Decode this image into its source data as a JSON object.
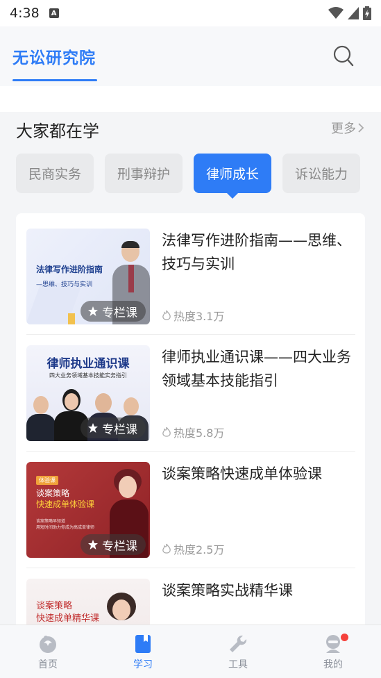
{
  "status": {
    "time": "4:38",
    "indicator": "A"
  },
  "header": {
    "brand_tab": "无讼研究院",
    "search_icon": "search-icon"
  },
  "section": {
    "title": "大家都在学",
    "more_label": "更多"
  },
  "categories": [
    {
      "label": "民商实务",
      "active": false
    },
    {
      "label": "刑事辩护",
      "active": false
    },
    {
      "label": "律师成长",
      "active": true
    },
    {
      "label": "诉讼能力",
      "active": false
    }
  ],
  "courses": [
    {
      "title": "法律写作进阶指南——思维、技巧与实训",
      "heat": "热度3.1万",
      "badge": "专栏课",
      "thumb_title": "法律写作进阶指南",
      "thumb_subtitle": "—思维、技巧与实训"
    },
    {
      "title": "律师执业通识课——四大业务领域基本技能指引",
      "heat": "热度5.8万",
      "badge": "专栏课",
      "thumb_title": "律师执业通识课",
      "thumb_subtitle": "四大业务领域基本技能实务指引"
    },
    {
      "title": "谈案策略快速成单体验课",
      "heat": "热度2.5万",
      "badge": "专栏课",
      "thumb_tag": "体验课",
      "thumb_title": "谈案策略",
      "thumb_subtitle": "快速成单体验课",
      "thumb_note1": "谈案策略早知道",
      "thumb_note2": "用短时间助力你成为高成单律师"
    },
    {
      "title": "谈案策略实战精华课",
      "thumb_title": "谈案策略",
      "thumb_subtitle": "快速成单精华课"
    }
  ],
  "tabbar": [
    {
      "label": "首页",
      "icon": "home-icon",
      "active": false
    },
    {
      "label": "学习",
      "icon": "book-icon",
      "active": true
    },
    {
      "label": "工具",
      "icon": "wrench-icon",
      "active": false
    },
    {
      "label": "我的",
      "icon": "profile-icon",
      "active": false,
      "dot": true
    }
  ],
  "colors": {
    "accent": "#2e7cf6",
    "badge_dot": "#f5413b"
  }
}
